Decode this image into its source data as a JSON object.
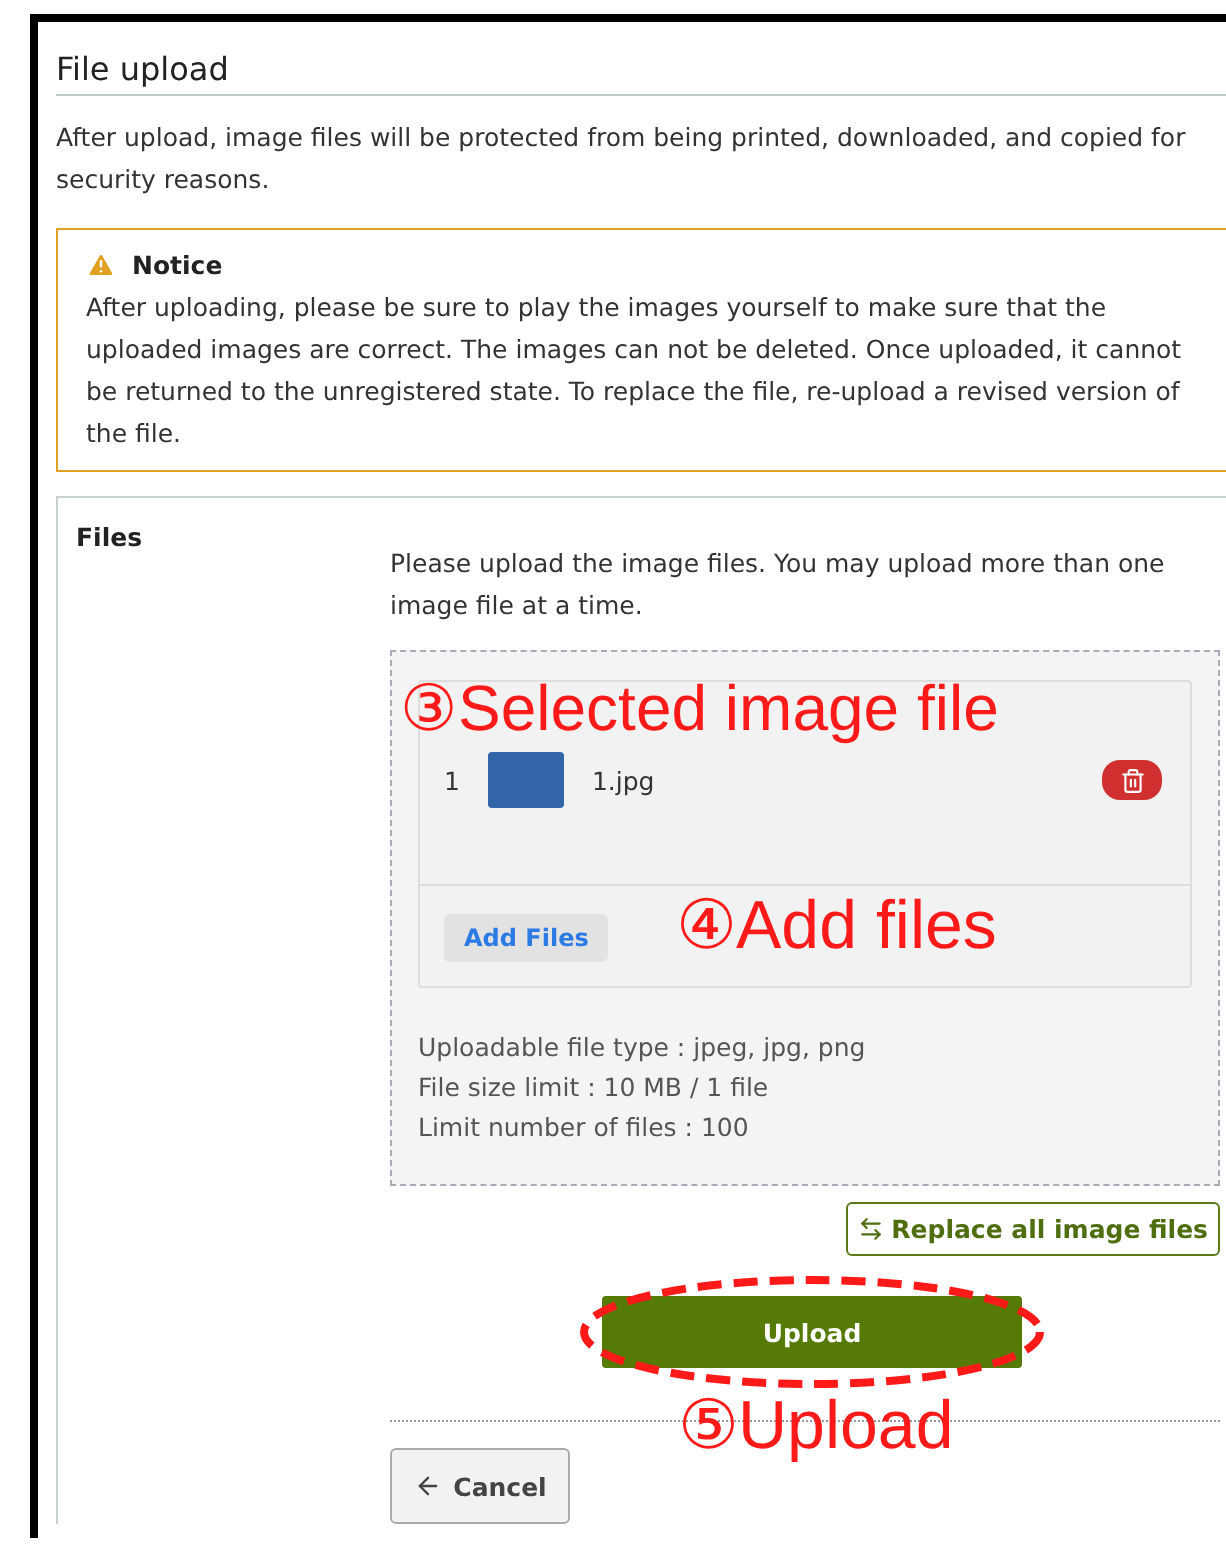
{
  "title": "File upload",
  "intro": "After upload, image files will be protected from being printed, downloaded, and copied for security reasons.",
  "notice": {
    "title": "Notice",
    "text": "After uploading, please be sure to play the images yourself to make sure that the uploaded images are correct. The images can not be deleted. Once uploaded, it cannot be returned to the unregistered state. To replace the file, re-upload a revised version of the file."
  },
  "files_section": {
    "label": "Files",
    "instructions": "Please upload the image files. You may upload more than one image file at a time.",
    "files": [
      {
        "index": "1",
        "name": "1.jpg"
      }
    ],
    "add_button": "Add Files",
    "limits": [
      "Uploadable file type : jpeg, jpg, png",
      "File size limit : 10 MB / 1 file",
      "Limit number of files : 100"
    ],
    "replace_button": "Replace all image files",
    "upload_button": "Upload",
    "cancel_button": "Cancel"
  },
  "annotations": [
    {
      "text": "③Selected image file"
    },
    {
      "text": "④Add files"
    },
    {
      "text": "⑤Upload"
    }
  ]
}
